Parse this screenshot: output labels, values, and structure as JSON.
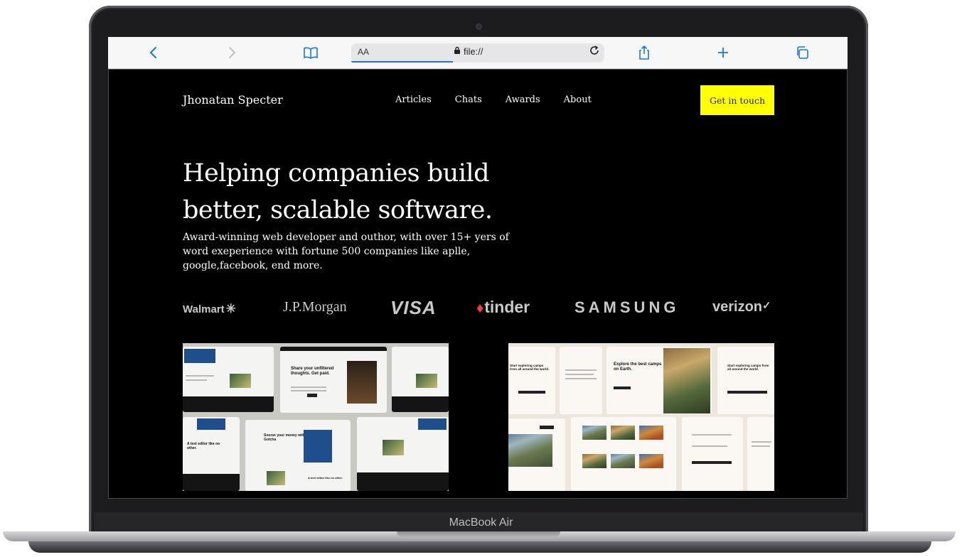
{
  "device": {
    "brand_label": "MacBook Air"
  },
  "browser": {
    "reader_label": "AA",
    "url": "file://",
    "icons": {
      "back": "chevron-left-icon",
      "forward": "chevron-right-icon",
      "bookmarks": "book-icon",
      "lock": "lock-icon",
      "reload": "reload-icon",
      "share": "share-icon",
      "new_tab": "plus-icon",
      "tabs": "tabs-icon"
    },
    "accent_color": "#1a73e8"
  },
  "site": {
    "name": "Jhonatan Specter",
    "nav": [
      {
        "label": "Articles"
      },
      {
        "label": "Chats"
      },
      {
        "label": "Awards"
      },
      {
        "label": "About"
      }
    ],
    "cta_label": "Get in touch",
    "cta_color": "#ffff00",
    "hero": {
      "title": "Helping companies build better, scalable software.",
      "subtitle": "Award-winning web developer and outhor, with over 15+ yers of word exeperience with fortune 500 companies like aplle, google,facebook, end more."
    },
    "client_logos": [
      "Walmart",
      "J.P.Morgan",
      "VISA",
      "tinder",
      "SAMSUNG",
      "verizon"
    ],
    "thumbnails": {
      "a": {
        "card_headline": "Share your unfiltered thoughts. Get paid.",
        "card_headline_2": "Sourse your money with Gotcha",
        "side_text": "A text editor like no other.",
        "side_text_2": "A text editor like no other."
      },
      "b": {
        "card_headline": "Explore the best camps on Earth.",
        "side_text": "Start exploring camps from all around the world.",
        "side_text_2": "Start exploring camps from all around the world."
      }
    }
  }
}
